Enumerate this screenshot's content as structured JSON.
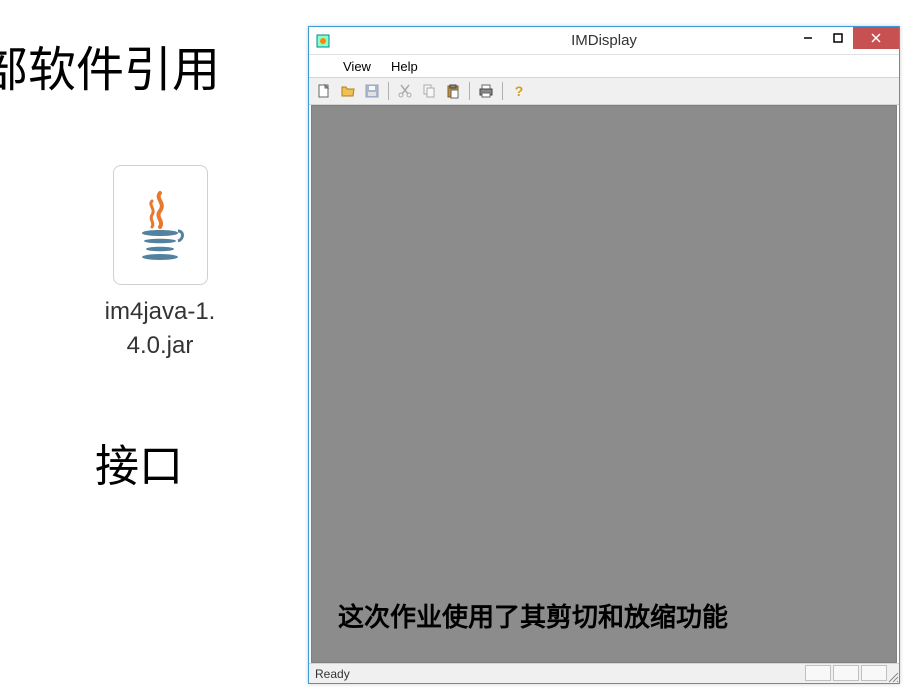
{
  "background": {
    "heading": "部软件引用",
    "jar_filename_line1": "im4java-1.",
    "jar_filename_line2": "4.0.jar",
    "interface_label": "接口"
  },
  "window": {
    "title": "IMDisplay",
    "menubar": {
      "view": "View",
      "help": "Help"
    },
    "toolbar_icons": {
      "new": "new-file-icon",
      "open": "open-folder-icon",
      "save": "save-icon",
      "cut": "cut-icon",
      "copy": "copy-icon",
      "paste": "paste-icon",
      "print": "print-icon",
      "help": "help-icon"
    },
    "overlay_text": "这次作业使用了其剪切和放缩功能",
    "status": "Ready"
  }
}
